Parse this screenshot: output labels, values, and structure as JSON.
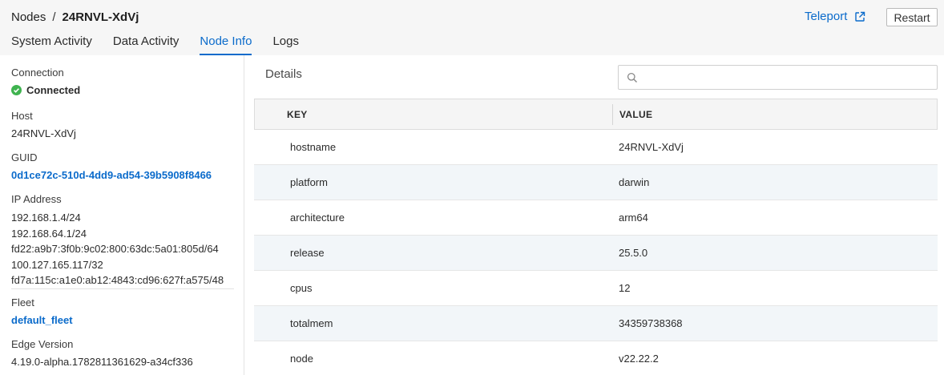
{
  "breadcrumb": {
    "root": "Nodes",
    "separator": "/",
    "current": "24RNVL-XdVj"
  },
  "tabs": [
    {
      "label": "System Activity",
      "active": false
    },
    {
      "label": "Data Activity",
      "active": false
    },
    {
      "label": "Node Info",
      "active": true
    },
    {
      "label": "Logs",
      "active": false
    }
  ],
  "header": {
    "teleport_label": "Teleport",
    "teleport_icon": "external-link-icon",
    "restart_label": "Restart"
  },
  "sidebar": {
    "connection_label": "Connection",
    "connection_status": "Connected",
    "connection_icon": "check-circle-icon",
    "host_label": "Host",
    "host_value": "24RNVL-XdVj",
    "guid_label": "GUID",
    "guid_value": "0d1ce72c-510d-4dd9-ad54-39b5908f8466",
    "ip_label": "IP Address",
    "ip_addresses": [
      "192.168.1.4/24",
      "192.168.64.1/24",
      "fd22:a9b7:3f0b:9c02:800:63dc:5a01:805d/64",
      "100.127.165.117/32",
      "fd7a:115c:a1e0:ab12:4843:cd96:627f:a575/48"
    ],
    "fleet_label": "Fleet",
    "fleet_value": "default_fleet",
    "edge_label": "Edge Version",
    "edge_value": "4.19.0-alpha.1782811361629-a34cf336"
  },
  "details": {
    "title": "Details",
    "search_placeholder": "",
    "search_icon": "search-icon",
    "columns": {
      "key": "KEY",
      "value": "VALUE"
    },
    "rows": [
      {
        "key": "hostname",
        "value": "24RNVL-XdVj"
      },
      {
        "key": "platform",
        "value": "darwin"
      },
      {
        "key": "architecture",
        "value": "arm64"
      },
      {
        "key": "release",
        "value": "25.5.0"
      },
      {
        "key": "cpus",
        "value": "12"
      },
      {
        "key": "totalmem",
        "value": "34359738368"
      },
      {
        "key": "node",
        "value": "v22.22.2"
      }
    ]
  },
  "colors": {
    "accent": "#0b6bcb",
    "success": "#3fb34f",
    "row_alt": "#f2f6f9"
  }
}
